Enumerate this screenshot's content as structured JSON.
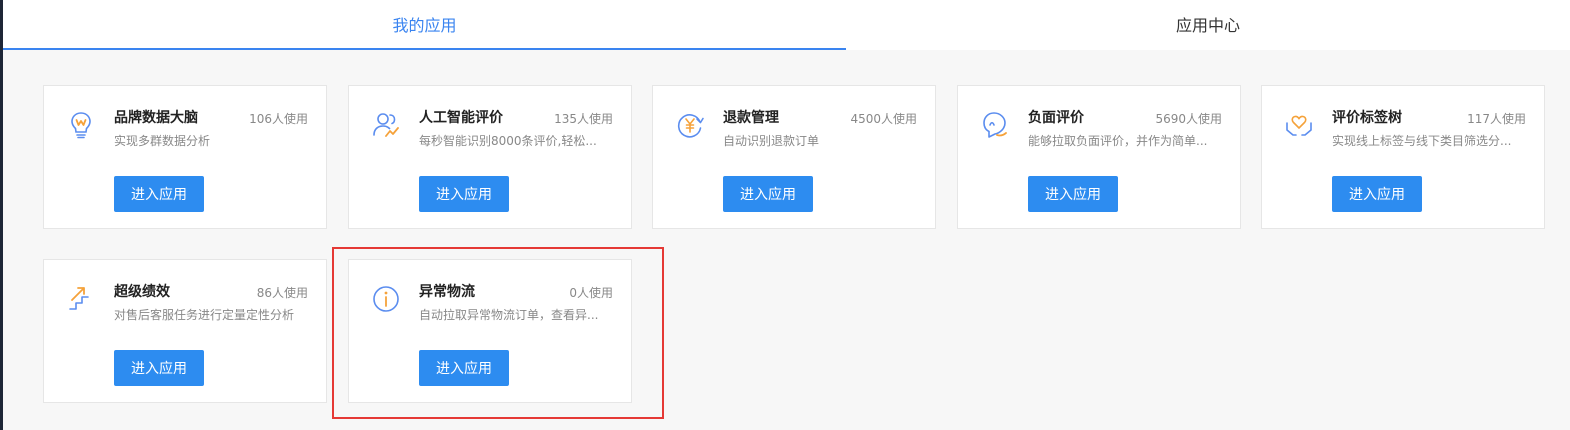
{
  "tabs": [
    {
      "label": "我的应用",
      "active": true
    },
    {
      "label": "应用中心",
      "active": false
    }
  ],
  "enter_label": "进入应用",
  "apps": [
    {
      "name": "品牌数据大脑",
      "users": "106人使用",
      "desc": "实现多群数据分析",
      "icon": "lightbulb-brain-icon"
    },
    {
      "name": "人工智能评价",
      "users": "135人使用",
      "desc": "每秒智能识别8000条评价,轻松...",
      "icon": "ai-users-icon"
    },
    {
      "name": "退款管理",
      "users": "4500人使用",
      "desc": "自动识别退款订单",
      "icon": "refund-yen-icon"
    },
    {
      "name": "负面评价",
      "users": "5690人使用",
      "desc": "能够拉取负面评价，并作为简单...",
      "icon": "negative-face-icon"
    },
    {
      "name": "评价标签树",
      "users": "117人使用",
      "desc": "实现线上标签与线下类目筛选分...",
      "icon": "heart-hands-icon"
    },
    {
      "name": "超级绩效",
      "users": "86人使用",
      "desc": "对售后客服任务进行定量定性分析",
      "icon": "stairs-arrow-icon"
    },
    {
      "name": "异常物流",
      "users": "0人使用",
      "desc": "自动拉取异常物流订单，查看异...",
      "icon": "info-circle-icon"
    }
  ],
  "colors": {
    "accent": "#3a84f0",
    "button": "#2d8cf0",
    "icon_blue": "#5b8def",
    "icon_orange": "#f5a23a",
    "highlight": "#e53935"
  }
}
